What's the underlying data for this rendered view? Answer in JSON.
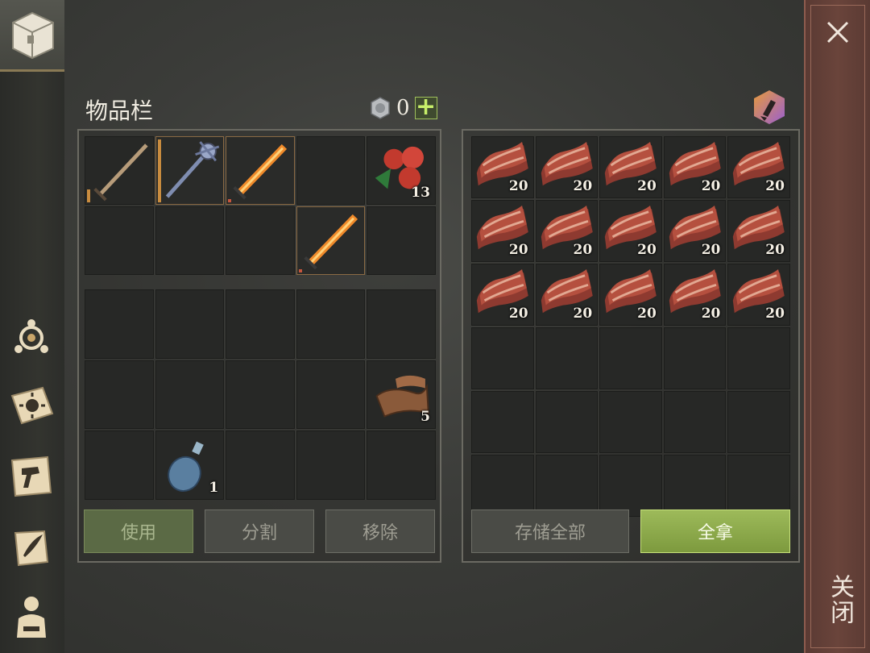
{
  "inventory": {
    "title": "物品栏",
    "currency_amount": "0",
    "equip_slots": [
      {
        "item": "wooden-sword-icon",
        "durability": 0.2
      },
      {
        "item": "iron-mace-icon",
        "durability": 0.95
      },
      {
        "item": "flaming-sword-icon",
        "durability": 0.05
      },
      {
        "item": "",
        "count": ""
      },
      {
        "item": "berries-icon",
        "count": "13"
      },
      {
        "item": "",
        "count": ""
      },
      {
        "item": "",
        "count": ""
      },
      {
        "item": "",
        "count": ""
      },
      {
        "item": "flaming-sword-icon",
        "durability": 0.05
      },
      {
        "item": "",
        "count": ""
      }
    ],
    "bag_counts": {
      "leather": "5",
      "flask": "1"
    },
    "buttons": {
      "use": "使用",
      "split": "分割",
      "remove": "移除"
    }
  },
  "storage": {
    "item": "raw-meat-icon",
    "stack_count": "20",
    "filled_slots": 15,
    "buttons": {
      "store_all": "存储全部",
      "take_all": "全拿"
    }
  },
  "close": {
    "label": "关闭"
  },
  "colors": {
    "accent_green": "#9dba5a",
    "meat": "#a4473a",
    "equip_border": "#8a6a44"
  }
}
